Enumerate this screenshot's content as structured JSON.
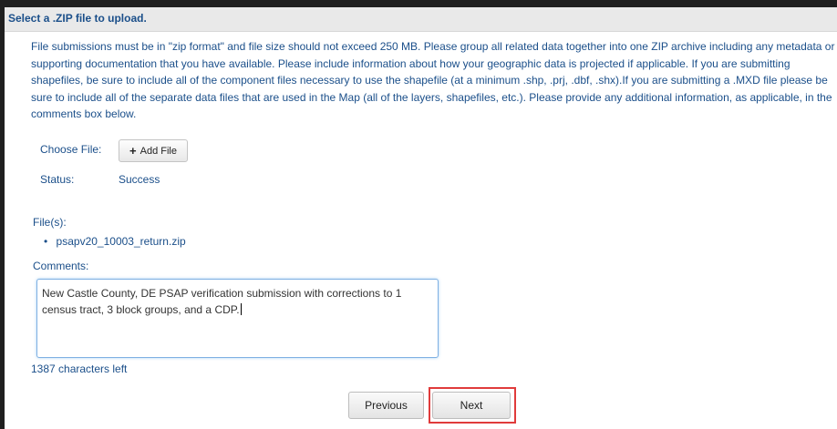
{
  "header": {
    "title": "Select a .ZIP file to upload."
  },
  "intro": {
    "text": "File submissions must be in \"zip format\" and file size should not exceed 250 MB. Please group all related data together into one ZIP archive including any metadata or supporting documentation that you have available. Please include information about how your geographic data is projected if applicable. If you are submitting shapefiles, be sure to include all of the component files necessary to use the shapefile (at a minimum .shp, .prj, .dbf, .shx).If you are submitting a .MXD file please be sure to include all of the separate data files that are used in the Map (all of the layers, shapefiles, etc.). Please provide any additional information, as applicable, in the comments box below."
  },
  "upload": {
    "choose_label": "Choose File:",
    "add_file_label": "Add File",
    "add_file_icon": "plus-icon",
    "status_label": "Status:",
    "status_value": "Success",
    "status_color": "#1b4f8a"
  },
  "files": {
    "label": "File(s):",
    "items": [
      "psapv20_10003_return.zip"
    ]
  },
  "comments": {
    "label": "Comments:",
    "value": "New Castle County, DE PSAP verification submission with corrections to 1 census tract, 3 block groups, and a CDP.",
    "chars_left": "1387 characters left"
  },
  "nav": {
    "previous_label": "Previous",
    "next_label": "Next",
    "highlight_color": "#e03b3b"
  }
}
